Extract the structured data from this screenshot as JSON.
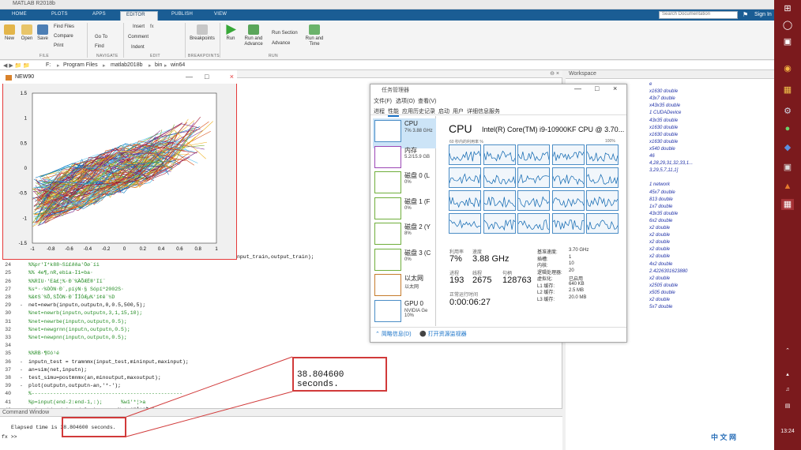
{
  "app": {
    "title": "MATLAB R2018b",
    "tabs": [
      "HOME",
      "PLOTS",
      "APPS",
      "EDITOR",
      "PUBLISH",
      "VIEW"
    ],
    "active_tab": "EDITOR",
    "search_placeholder": "Search Documentation",
    "sign_in": "Sign In"
  },
  "ribbon": {
    "new": "New",
    "open": "Open",
    "save": "Save",
    "find_files": "Find Files",
    "compare": "Compare",
    "print": "Print",
    "goto": "Go To",
    "find": "Find",
    "insert": "Insert",
    "comment": "Comment",
    "indent": "Indent",
    "breakpoints": "Breakpoints",
    "run": "Run",
    "run_advance": "Run and Advance",
    "run_section": "Run Section",
    "advance": "Advance",
    "run_time": "Run and Time",
    "sections": [
      "FILE",
      "NAVIGATE",
      "EDIT",
      "BREAKPOINTS",
      "RUN"
    ]
  },
  "breadcrumb": [
    "F:",
    "Program Files",
    "matlab2018b",
    "bin",
    "win64"
  ],
  "figure": {
    "title": "NEW90",
    "x_ticks": [
      "-1",
      "-0.8",
      "-0.6",
      "-0.4",
      "-0.2",
      "0",
      "0.2",
      "0.4",
      "0.6",
      "0.8",
      "1"
    ],
    "y_ticks": [
      "1.5",
      "1",
      "0.5",
      "0",
      "-0.5",
      "-1",
      "-1.5"
    ]
  },
  "editor": {
    "lines": [
      {
        "n": "",
        "t": "nput_train,output_train);",
        "c": "kw",
        "x": 300
      },
      {
        "n": "24",
        "t": "%%pr'I*k88~Sï£ðða'Öø´íi",
        "c": "cm"
      },
      {
        "n": "25",
        "t": "%% 4e¶,nR,ebia-I1=ba·",
        "c": "cm"
      },
      {
        "n": "26",
        "t": "%%RIU·­'Eâ£¦%·Ð´%ÀÕÆË®'Iï¨",
        "c": "cm"
      },
      {
        "n": "27",
        "t": "%sº··%ÒÒN·Ð´,píýN·§ Sópïº2002S·",
        "c": "cm"
      },
      {
        "n": "28",
        "t": "%&¢S´%Õ,SÎÒN·Ð´ÎÍÓÆµ%'ï¢ê¨½D",
        "c": "cm"
      },
      {
        "n": "29",
        "t": "net=newrb(inputn,outputn,0,0.5,500,5);",
        "c": "kw",
        "d": true
      },
      {
        "n": "30",
        "t": "%net=newrb(inputn,outputn,3,1,15,10);",
        "c": "cm"
      },
      {
        "n": "31",
        "t": "%net=newrbe(inputn,outputn,0.5);",
        "c": "cm"
      },
      {
        "n": "32",
        "t": "%net=newgrnn(inputn,outputn,0.5);",
        "c": "cm"
      },
      {
        "n": "33",
        "t": "%net=newpnn(inputn,outputn,0.5);",
        "c": "cm"
      },
      {
        "n": "34",
        "t": "",
        "c": "kw"
      },
      {
        "n": "35",
        "t": "%%RB·¶©ó¹é",
        "c": "cm"
      },
      {
        "n": "36",
        "t": "inputn_test = tramnmx(input_test,mininput,maxinput);",
        "c": "kw",
        "d": true
      },
      {
        "n": "37",
        "t": "an=sim(net,inputn);",
        "c": "kw",
        "d": true
      },
      {
        "n": "38",
        "t": "test_simu=postmnmx(an,minoutput,maxoutput);",
        "c": "kw",
        "d": true
      },
      {
        "n": "39",
        "t": "plot(outputn,outputn-an,'*-');",
        "c": "kw",
        "d": true
      },
      {
        "n": "40",
        "t": "%-------------------------------------------------",
        "c": "cm"
      },
      {
        "n": "41",
        "t": "%p=input(end-2:end-1,:);      %w1'*¦>a",
        "c": "cm"
      },
      {
        "n": "42",
        "t": "p=input(end-1:end-0,:);      %¸¢·²®Â³´Èsî<",
        "c": "kw",
        "d": true
      }
    ]
  },
  "command_window": {
    "title": "Command Window",
    "output": "Elapsed time is 38.804600 seconds.",
    "prompt": "fx >>"
  },
  "callout": "38.804600 seconds.",
  "workspace": {
    "title": "Workspace",
    "values": [
      "e",
      "x1630 double",
      "43x7 double",
      "x43x35 double",
      "1 CUDADevice",
      "43x35 double",
      "x1630 double",
      "x1630 double",
      "x1630 double",
      "x540 double",
      "46",
      "4,28,29,31,32,33,1...",
      "3,29,5,7,11,1]",
      "",
      "1 network",
      "45x7 double",
      "813 double",
      "1x7 double",
      "43x35 double",
      "6x2 double",
      "x2 double",
      "x2 double",
      "x2 double",
      "x2 double",
      "x2 double",
      "4x2 double",
      "2.4226301623880",
      "x2 double",
      "x2505 double",
      "x505 double",
      "x2 double",
      "5x7 double"
    ]
  },
  "task_manager": {
    "title": "任务管理器",
    "menu": [
      "文件(F)",
      "选项(O)",
      "查看(V)"
    ],
    "tabs": [
      "进程",
      "性能",
      "应用历史记录",
      "启动",
      "用户",
      "详细信息",
      "服务"
    ],
    "side": [
      {
        "label": "CPU",
        "sub": "7%  3.88 GHz"
      },
      {
        "label": "内存",
        "sub": "5.2/15.9 GB"
      },
      {
        "label": "磁盘 0 (L",
        "sub": "0%"
      },
      {
        "label": "磁盘 1 (F",
        "sub": "0%"
      },
      {
        "label": "磁盘 2 (Y",
        "sub": "8%"
      },
      {
        "label": "磁盘 3 (C",
        "sub": "0%"
      },
      {
        "label": "以太网",
        "sub": "以太网"
      },
      {
        "label": "GPU 0",
        "sub": "NVIDIA Ge 10%"
      }
    ],
    "cpu_header": "CPU",
    "cpu_name": "Intel(R) Core(TM) i9-10900KF CPU @ 3.70...",
    "graph_label": "60 秒内的利用率 %",
    "graph_max": "100%",
    "utilization_label": "利用率",
    "utilization": "7%",
    "speed_label": "速度",
    "speed": "3.88 GHz",
    "process_label": "进程",
    "processes": "193",
    "thread_label": "线程",
    "threads": "2675",
    "handle_label": "句柄",
    "handles": "128763",
    "uptime_label": "正常运行时间",
    "uptime": "0:00:06:27",
    "right": [
      [
        "基准速度:",
        "3.70 GHz"
      ],
      [
        "插槽:",
        "1"
      ],
      [
        "内核:",
        "10"
      ],
      [
        "逻辑处理器:",
        "20"
      ],
      [
        "虚拟化:",
        "已启用"
      ],
      [
        "L1 缓存:",
        "640 KB"
      ],
      [
        "L2 缓存:",
        "2.5 MB"
      ],
      [
        "L3 缓存:",
        "20.0 MB"
      ]
    ],
    "less": "简略信息(D)",
    "open_monitor": "打开资源监视器"
  },
  "taskbar": {
    "time": "13:24"
  },
  "watermark": "中 文 网"
}
